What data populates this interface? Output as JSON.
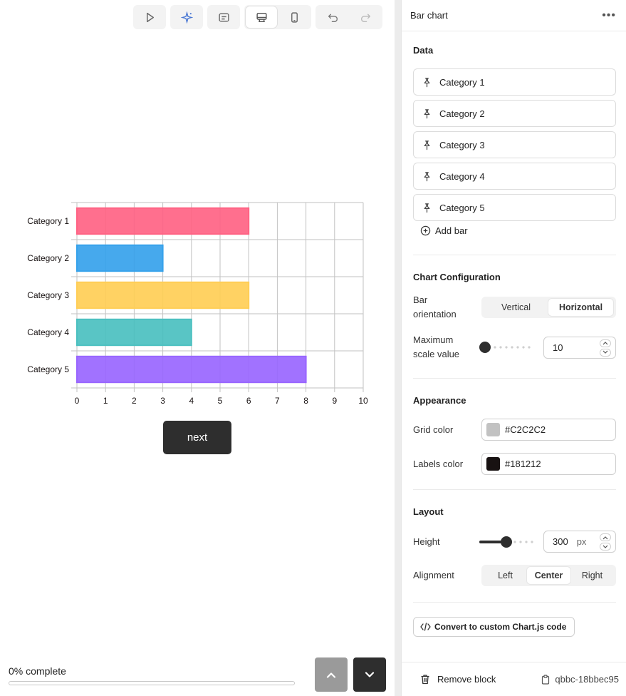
{
  "toolbar": {
    "icons": [
      "play-icon",
      "sparkle-icon",
      "preview-icon",
      "desktop-icon",
      "mobile-icon",
      "undo-icon",
      "redo-icon"
    ]
  },
  "chart_data": {
    "type": "bar",
    "orientation": "horizontal",
    "categories": [
      "Category 1",
      "Category 2",
      "Category 3",
      "Category 4",
      "Category 5"
    ],
    "values": [
      6,
      3,
      6,
      4,
      8
    ],
    "colors": [
      "#FF6384",
      "#36A2EB",
      "#FFCE56",
      "#4BC0C0",
      "#9966FF"
    ],
    "xlim": [
      0,
      10
    ],
    "xticks": [
      "0",
      "1",
      "2",
      "3",
      "4",
      "5",
      "6",
      "7",
      "8",
      "9",
      "10"
    ],
    "grid": true,
    "grid_color": "#C2C2C2",
    "labels_color": "#181212",
    "title": "",
    "xlabel": "",
    "ylabel": ""
  },
  "canvas": {
    "next_label": "next",
    "progress_text": "0% complete",
    "progress_value": 0
  },
  "panel": {
    "title": "Bar chart",
    "data_title": "Data",
    "items": [
      {
        "label": "Category 1"
      },
      {
        "label": "Category 2"
      },
      {
        "label": "Category 3"
      },
      {
        "label": "Category 4"
      },
      {
        "label": "Category 5"
      }
    ],
    "add_bar_label": "Add bar",
    "config_title": "Chart Configuration",
    "orientation_label_1": "Bar",
    "orientation_label_2": "orientation",
    "orientation_options": [
      "Vertical",
      "Horizontal"
    ],
    "orientation_selected": "Horizontal",
    "max_label_1": "Maximum",
    "max_label_2": "scale value",
    "max_value": "10",
    "max_slider_fraction": 0.0,
    "appearance_title": "Appearance",
    "grid_color_label": "Grid color",
    "grid_color_value": "#C2C2C2",
    "labels_color_label": "Labels color",
    "labels_color_value": "#181212",
    "layout_title": "Layout",
    "height_label": "Height",
    "height_value": "300",
    "height_unit": "px",
    "alignment_label": "Alignment",
    "alignment_options": [
      "Left",
      "Center",
      "Right"
    ],
    "alignment_selected": "Center",
    "convert_label": "Convert to custom Chart.js code",
    "remove_label": "Remove block",
    "block_id": "qbbc-18bbec95"
  }
}
